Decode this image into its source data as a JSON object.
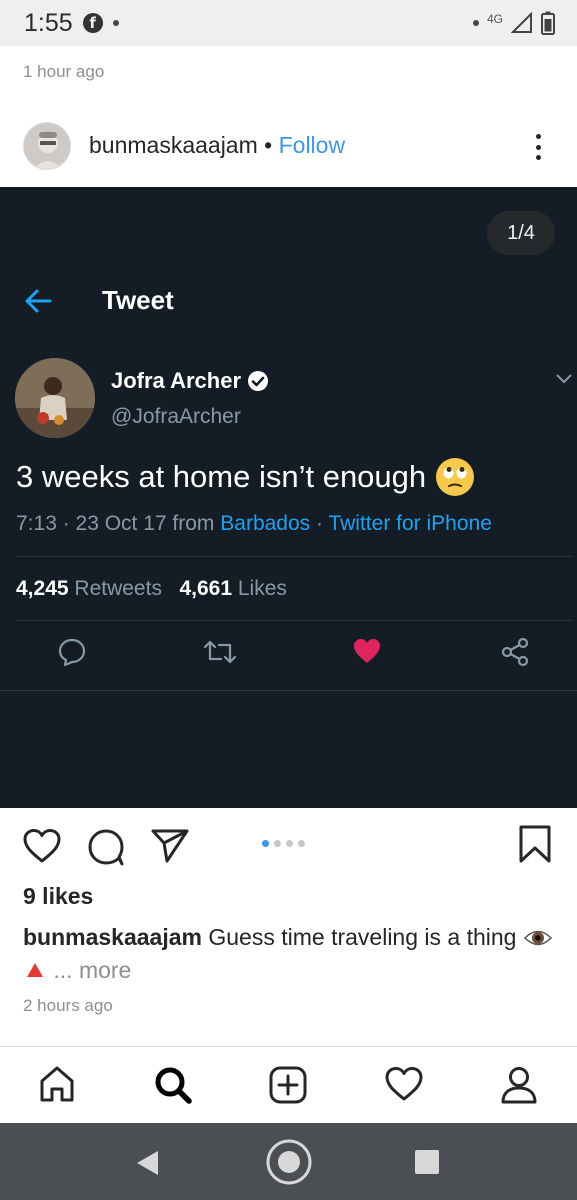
{
  "status_bar": {
    "time": "1:55",
    "network": "4G"
  },
  "previous_post": {
    "timestamp": "1 hour ago"
  },
  "post": {
    "username": "bunmaskaaajam",
    "separator": "•",
    "follow_label": "Follow",
    "carousel_counter": "1/4",
    "likes": "9 likes",
    "caption_user": "bunmaskaaajam",
    "caption_text": "Guess time traveling is a thing",
    "caption_more": "... more",
    "timestamp": "2 hours ago"
  },
  "tweet": {
    "header_title": "Tweet",
    "author_name": "Jofra Archer",
    "author_handle": "@JofraArcher",
    "text": "3 weeks at home isn’t enough",
    "time_date": "7:13 · 23 Oct 17 from ",
    "location": "Barbados",
    "meta_sep": " · ",
    "client": "Twitter for iPhone",
    "retweets_count": "4,245",
    "retweets_label": "Retweets",
    "likes_count": "4,661",
    "likes_label": "Likes"
  },
  "carousel": {
    "total": 4,
    "active_index": 0
  },
  "icons": {
    "post_actions": [
      "heart-icon",
      "comment-icon",
      "share-icon",
      "bookmark-icon"
    ],
    "bottom_nav": [
      "home-icon",
      "search-icon",
      "add-post-icon",
      "activity-heart-icon",
      "profile-icon"
    ],
    "android_nav": [
      "back-icon",
      "home-circle-icon",
      "recents-icon"
    ]
  },
  "colors": {
    "link_blue": "#3897f0",
    "twitter_bg": "#141d26",
    "twitter_blue": "#1da1f2",
    "like_red": "#e0245e"
  }
}
